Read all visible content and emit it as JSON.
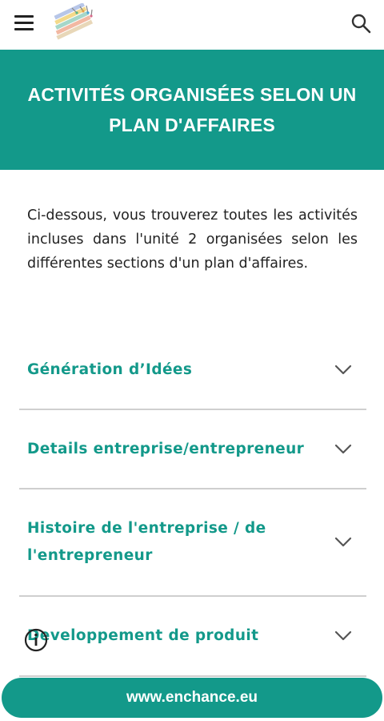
{
  "header": {
    "menu_icon": "hamburger-menu-icon",
    "logo": "site-logo",
    "search_icon": "search-icon"
  },
  "hero": {
    "title": "ACTIVITÉS ORGANISÉES SELON UN PLAN D'AFFAIRES"
  },
  "intro": {
    "text": "Ci-dessous, vous trouverez toutes les activités incluses dans l'unité 2 organisées selon les différentes sections d'un plan d'affaires."
  },
  "accordion": {
    "items": [
      {
        "label": "Génération d’Idées"
      },
      {
        "label": "Details entreprise/entrepreneur"
      },
      {
        "label": "Histoire de l'entreprise / de l'entrepreneur"
      },
      {
        "label": "Developpement de produit"
      }
    ]
  },
  "footer": {
    "link_label": "www.enchance.eu"
  },
  "colors": {
    "accent": "#13998a",
    "divider": "#cfcfcf",
    "text": "#222222"
  }
}
